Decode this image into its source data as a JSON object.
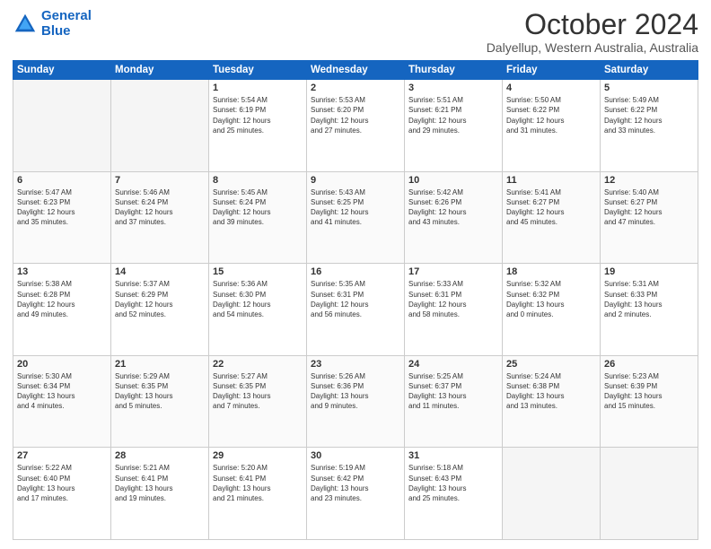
{
  "logo": {
    "line1": "General",
    "line2": "Blue"
  },
  "title": "October 2024",
  "subtitle": "Dalyellup, Western Australia, Australia",
  "days_of_week": [
    "Sunday",
    "Monday",
    "Tuesday",
    "Wednesday",
    "Thursday",
    "Friday",
    "Saturday"
  ],
  "weeks": [
    [
      {
        "day": "",
        "info": ""
      },
      {
        "day": "",
        "info": ""
      },
      {
        "day": "1",
        "info": "Sunrise: 5:54 AM\nSunset: 6:19 PM\nDaylight: 12 hours\nand 25 minutes."
      },
      {
        "day": "2",
        "info": "Sunrise: 5:53 AM\nSunset: 6:20 PM\nDaylight: 12 hours\nand 27 minutes."
      },
      {
        "day": "3",
        "info": "Sunrise: 5:51 AM\nSunset: 6:21 PM\nDaylight: 12 hours\nand 29 minutes."
      },
      {
        "day": "4",
        "info": "Sunrise: 5:50 AM\nSunset: 6:22 PM\nDaylight: 12 hours\nand 31 minutes."
      },
      {
        "day": "5",
        "info": "Sunrise: 5:49 AM\nSunset: 6:22 PM\nDaylight: 12 hours\nand 33 minutes."
      }
    ],
    [
      {
        "day": "6",
        "info": "Sunrise: 5:47 AM\nSunset: 6:23 PM\nDaylight: 12 hours\nand 35 minutes."
      },
      {
        "day": "7",
        "info": "Sunrise: 5:46 AM\nSunset: 6:24 PM\nDaylight: 12 hours\nand 37 minutes."
      },
      {
        "day": "8",
        "info": "Sunrise: 5:45 AM\nSunset: 6:24 PM\nDaylight: 12 hours\nand 39 minutes."
      },
      {
        "day": "9",
        "info": "Sunrise: 5:43 AM\nSunset: 6:25 PM\nDaylight: 12 hours\nand 41 minutes."
      },
      {
        "day": "10",
        "info": "Sunrise: 5:42 AM\nSunset: 6:26 PM\nDaylight: 12 hours\nand 43 minutes."
      },
      {
        "day": "11",
        "info": "Sunrise: 5:41 AM\nSunset: 6:27 PM\nDaylight: 12 hours\nand 45 minutes."
      },
      {
        "day": "12",
        "info": "Sunrise: 5:40 AM\nSunset: 6:27 PM\nDaylight: 12 hours\nand 47 minutes."
      }
    ],
    [
      {
        "day": "13",
        "info": "Sunrise: 5:38 AM\nSunset: 6:28 PM\nDaylight: 12 hours\nand 49 minutes."
      },
      {
        "day": "14",
        "info": "Sunrise: 5:37 AM\nSunset: 6:29 PM\nDaylight: 12 hours\nand 52 minutes."
      },
      {
        "day": "15",
        "info": "Sunrise: 5:36 AM\nSunset: 6:30 PM\nDaylight: 12 hours\nand 54 minutes."
      },
      {
        "day": "16",
        "info": "Sunrise: 5:35 AM\nSunset: 6:31 PM\nDaylight: 12 hours\nand 56 minutes."
      },
      {
        "day": "17",
        "info": "Sunrise: 5:33 AM\nSunset: 6:31 PM\nDaylight: 12 hours\nand 58 minutes."
      },
      {
        "day": "18",
        "info": "Sunrise: 5:32 AM\nSunset: 6:32 PM\nDaylight: 13 hours\nand 0 minutes."
      },
      {
        "day": "19",
        "info": "Sunrise: 5:31 AM\nSunset: 6:33 PM\nDaylight: 13 hours\nand 2 minutes."
      }
    ],
    [
      {
        "day": "20",
        "info": "Sunrise: 5:30 AM\nSunset: 6:34 PM\nDaylight: 13 hours\nand 4 minutes."
      },
      {
        "day": "21",
        "info": "Sunrise: 5:29 AM\nSunset: 6:35 PM\nDaylight: 13 hours\nand 5 minutes."
      },
      {
        "day": "22",
        "info": "Sunrise: 5:27 AM\nSunset: 6:35 PM\nDaylight: 13 hours\nand 7 minutes."
      },
      {
        "day": "23",
        "info": "Sunrise: 5:26 AM\nSunset: 6:36 PM\nDaylight: 13 hours\nand 9 minutes."
      },
      {
        "day": "24",
        "info": "Sunrise: 5:25 AM\nSunset: 6:37 PM\nDaylight: 13 hours\nand 11 minutes."
      },
      {
        "day": "25",
        "info": "Sunrise: 5:24 AM\nSunset: 6:38 PM\nDaylight: 13 hours\nand 13 minutes."
      },
      {
        "day": "26",
        "info": "Sunrise: 5:23 AM\nSunset: 6:39 PM\nDaylight: 13 hours\nand 15 minutes."
      }
    ],
    [
      {
        "day": "27",
        "info": "Sunrise: 5:22 AM\nSunset: 6:40 PM\nDaylight: 13 hours\nand 17 minutes."
      },
      {
        "day": "28",
        "info": "Sunrise: 5:21 AM\nSunset: 6:41 PM\nDaylight: 13 hours\nand 19 minutes."
      },
      {
        "day": "29",
        "info": "Sunrise: 5:20 AM\nSunset: 6:41 PM\nDaylight: 13 hours\nand 21 minutes."
      },
      {
        "day": "30",
        "info": "Sunrise: 5:19 AM\nSunset: 6:42 PM\nDaylight: 13 hours\nand 23 minutes."
      },
      {
        "day": "31",
        "info": "Sunrise: 5:18 AM\nSunset: 6:43 PM\nDaylight: 13 hours\nand 25 minutes."
      },
      {
        "day": "",
        "info": ""
      },
      {
        "day": "",
        "info": ""
      }
    ]
  ]
}
